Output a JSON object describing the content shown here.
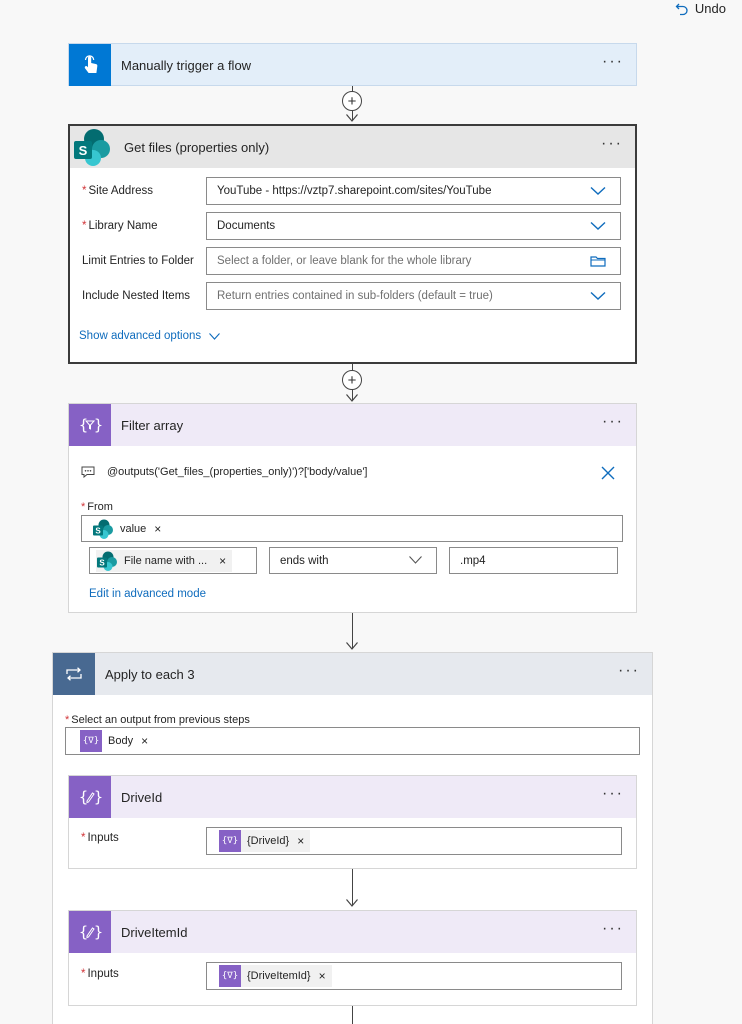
{
  "toolbar": {
    "undo_label": "Undo"
  },
  "trigger": {
    "title": "Manually trigger a flow",
    "more": "···"
  },
  "getfiles": {
    "title": "Get files (properties only)",
    "more": "···",
    "site_label": "Site Address",
    "site_value": "YouTube - https://vztp7.sharepoint.com/sites/YouTube",
    "library_label": "Library Name",
    "library_value": "Documents",
    "folder_label": "Limit Entries to Folder",
    "folder_placeholder": "Select a folder, or leave blank for the whole library",
    "nested_label": "Include Nested Items",
    "nested_placeholder": "Return entries contained in sub-folders (default = true)",
    "advanced_label": "Show advanced options"
  },
  "filter": {
    "title": "Filter array",
    "more": "···",
    "expression": "@outputs('Get_files_(properties_only)')?['body/value']",
    "from_label": "From",
    "from_token": "value",
    "cond_token": "File name with ...",
    "operator": "ends with",
    "cond_value": ".mp4",
    "edit_advanced": "Edit in advanced mode"
  },
  "apply": {
    "title": "Apply to each 3",
    "more": "···",
    "select_label": "Select an output from previous steps",
    "select_token": "Body"
  },
  "driveid": {
    "title": "DriveId",
    "more": "···",
    "inputs_label": "Inputs",
    "token": "{DriveId}"
  },
  "driveitemid": {
    "title": "DriveItemId",
    "more": "···",
    "inputs_label": "Inputs",
    "token": "{DriveItemId}"
  },
  "common": {
    "required": "*",
    "remove": "×",
    "plus": "+"
  },
  "colors": {
    "trigger_blue": "#0078d4",
    "sharepoint_teal": "#038387",
    "compose_purple": "#8661c5",
    "loop_slate": "#486991"
  }
}
